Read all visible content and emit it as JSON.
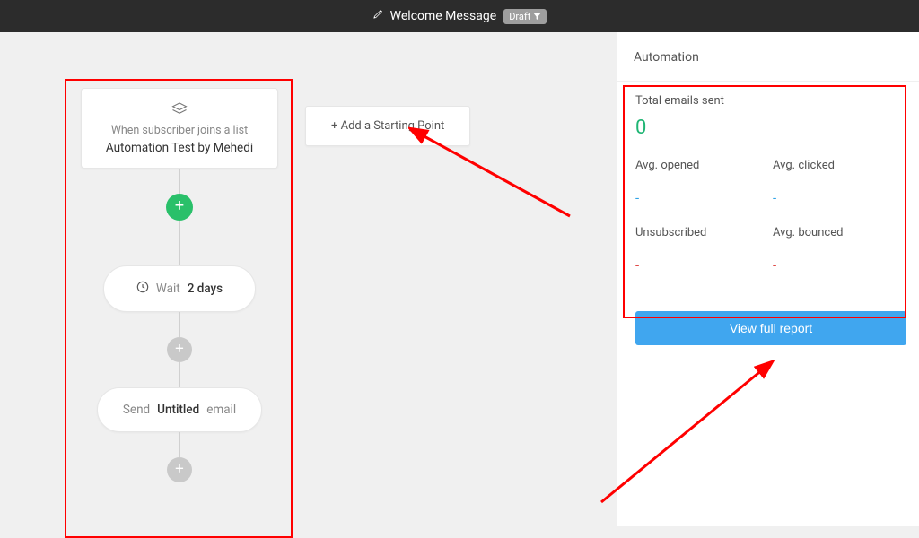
{
  "topbar": {
    "title": "Welcome Message",
    "badge": "Draft"
  },
  "canvas": {
    "trigger": {
      "subtitle": "When subscriber joins a list",
      "value": "Automation Test by Mehedi"
    },
    "wait_prefix": "Wait",
    "wait_value": "2 days",
    "send_prefix": "Send",
    "send_name": "Untitled",
    "send_suffix": "email",
    "add_starting_label": "+ Add a Starting Point"
  },
  "sidebar": {
    "title": "Automation",
    "total_label": "Total emails sent",
    "total_value": "0",
    "avg_opened_label": "Avg. opened",
    "avg_opened_value": "-",
    "avg_clicked_label": "Avg. clicked",
    "avg_clicked_value": "-",
    "unsub_label": "Unsubscribed",
    "unsub_value": "-",
    "avg_bounced_label": "Avg. bounced",
    "avg_bounced_value": "-",
    "report_btn": "View full report"
  }
}
